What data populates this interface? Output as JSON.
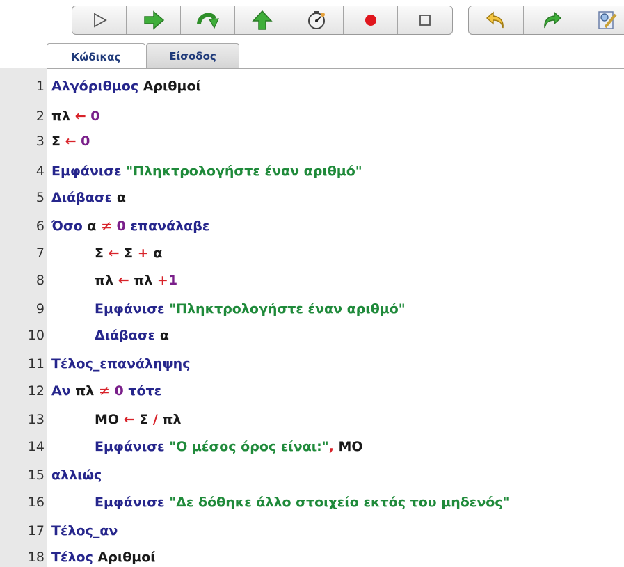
{
  "toolbar": {
    "run_buttons": [
      {
        "name": "run-icon"
      },
      {
        "name": "step-into-icon"
      },
      {
        "name": "step-over-icon"
      },
      {
        "name": "step-out-icon"
      },
      {
        "name": "speed-icon"
      },
      {
        "name": "breakpoint-icon"
      },
      {
        "name": "stop-icon"
      }
    ],
    "edit_buttons": [
      {
        "name": "undo-icon"
      },
      {
        "name": "redo-icon"
      },
      {
        "name": "edit-icon"
      }
    ]
  },
  "tabs": [
    {
      "label": "Κώδικας",
      "active": true
    },
    {
      "label": "Είσοδος",
      "active": false
    }
  ],
  "code_lines": [
    {
      "n": "1",
      "kw1": "Αλγόριθμος",
      "rest": "Αριθμοί"
    },
    {
      "n": "2",
      "var": "πλ",
      "arrow": "←",
      "val": "0"
    },
    {
      "n": "3",
      "var": "Σ",
      "arrow": "←",
      "val": "0"
    },
    {
      "n": "4",
      "kw1": "Εμφάνισε",
      "str": "\"Πληκτρολογήστε έναν αριθμό\""
    },
    {
      "n": "5",
      "kw1": "Διάβασε",
      "rest": "α"
    },
    {
      "n": "6",
      "kw1": "Όσο",
      "var": "α",
      "neq": "≠",
      "val": "0",
      "kw2": "επανάλαβε"
    },
    {
      "n": "7",
      "lhs": "Σ",
      "arrow": "←",
      "a": "Σ",
      "plus": "+",
      "b": "α"
    },
    {
      "n": "8",
      "lhs": "πλ",
      "arrow": "←",
      "a": "πλ",
      "plus": "+",
      "val": "1"
    },
    {
      "n": "9",
      "kw1": "Εμφάνισε",
      "str": "\"Πληκτρολογήστε έναν αριθμό\""
    },
    {
      "n": "10",
      "kw1": "Διάβασε",
      "rest": "α"
    },
    {
      "n": "11",
      "kw1": "Τέλος_επανάληψης"
    },
    {
      "n": "12",
      "kw1": "Αν",
      "var": "πλ",
      "neq": "≠",
      "val": "0",
      "kw2": "τότε"
    },
    {
      "n": "13",
      "lhs": "ΜΟ",
      "arrow": "←",
      "a": "Σ",
      "div": "/",
      "b": "πλ"
    },
    {
      "n": "14",
      "kw1": "Εμφάνισε",
      "str": "\"Ο μέσος όρος είναι:\"",
      "comma": ",",
      "rest": "ΜΟ"
    },
    {
      "n": "15",
      "kw1": "αλλιώς"
    },
    {
      "n": "16",
      "kw1": "Εμφάνισε",
      "str": "\"Δε δόθηκε άλλο στοιχείο εκτός του μηδενός\""
    },
    {
      "n": "17",
      "kw1": "Τέλος_αν"
    },
    {
      "n": "18",
      "kw1": "Τέλος",
      "rest": "Αριθμοί"
    }
  ]
}
